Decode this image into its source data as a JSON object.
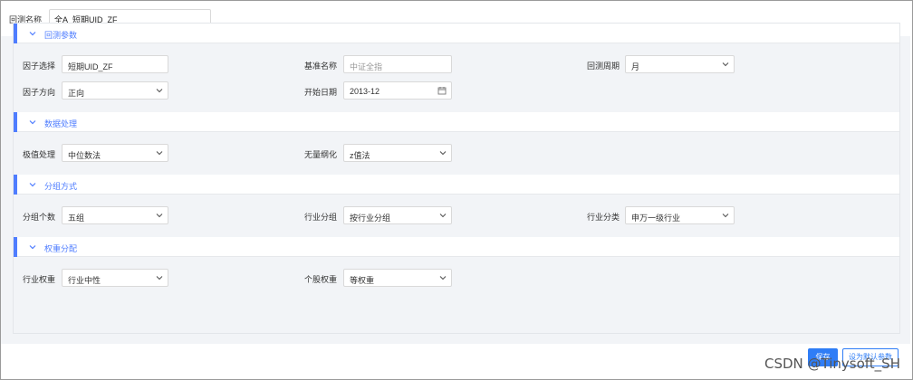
{
  "header": {
    "name_label": "回测名称",
    "name_value": "全A_短期UID_ZF"
  },
  "sections": [
    {
      "title": "回测参数"
    },
    {
      "title": "数据处理"
    },
    {
      "title": "分组方式"
    },
    {
      "title": "权重分配"
    }
  ],
  "backtest": {
    "factor_select_label": "因子选择",
    "factor_select_value": "短期UID_ZF",
    "benchmark_label": "基准名称",
    "benchmark_placeholder": "中证全指",
    "period_label": "回测周期",
    "period_value": "月",
    "direction_label": "因子方向",
    "direction_value": "正向",
    "start_date_label": "开始日期",
    "start_date_value": "2013-12"
  },
  "processing": {
    "extreme_label": "极值处理",
    "extreme_value": "中位数法",
    "dimensionless_label": "无量纲化",
    "dimensionless_value": "z值法"
  },
  "grouping": {
    "count_label": "分组个数",
    "count_value": "五组",
    "industry_group_label": "行业分组",
    "industry_group_value": "按行业分组",
    "industry_class_label": "行业分类",
    "industry_class_value": "申万一级行业"
  },
  "weights": {
    "industry_weight_label": "行业权重",
    "industry_weight_value": "行业中性",
    "stock_weight_label": "个股权重",
    "stock_weight_value": "等权重"
  },
  "buttons": {
    "primary_label": "保存",
    "secondary_label": "设为默认参数"
  },
  "watermark": "CSDN @Tinysoft_SH",
  "colors": {
    "accent": "#4f7dff",
    "primary_button": "#2f7df6",
    "panel_bg": "#f2f4f7"
  },
  "icons": {
    "section_toggle": "chevron-down-icon",
    "dropdown": "caret-down-icon",
    "date": "calendar-icon"
  }
}
